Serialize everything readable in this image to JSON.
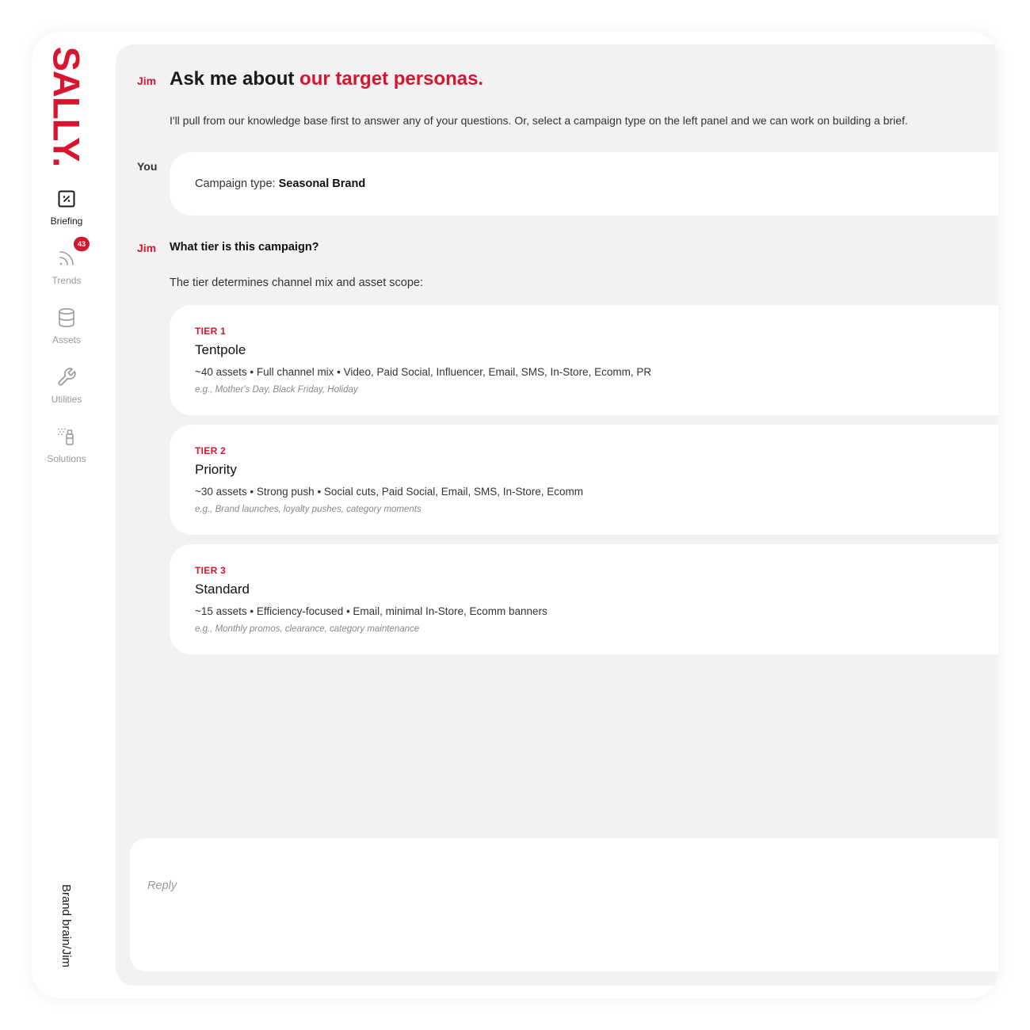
{
  "app": {
    "logo": "SALLY.",
    "brand_path": "Brand brain/Jim"
  },
  "colors": {
    "accent": "#d7152f",
    "panel": "#f2f2f2",
    "card": "#ffffff"
  },
  "sidebar": {
    "items": [
      {
        "label": "Briefing",
        "icon": "briefing-icon",
        "active": true
      },
      {
        "label": "Trends",
        "icon": "rss-icon",
        "badge": "43"
      },
      {
        "label": "Assets",
        "icon": "database-icon"
      },
      {
        "label": "Utilities",
        "icon": "wrench-icon"
      },
      {
        "label": "Solutions",
        "icon": "spray-bottle-icon"
      }
    ]
  },
  "chat": {
    "jim_name": "Jim",
    "you_name": "You",
    "headline_prefix": "Ask me about ",
    "headline_highlight": "our target personas.",
    "intro": "I'll pull from our knowledge base first to answer any of your questions. Or, select a campaign type on the left panel and we can work on building a brief.",
    "you_message_label": "Campaign type: ",
    "you_message_value": "Seasonal Brand",
    "question": "What tier is this campaign?",
    "question_sub": "The tier determines channel mix and asset scope:",
    "tiers": [
      {
        "label": "TIER 1",
        "name": "Tentpole",
        "desc": "~40 assets • Full channel mix • Video, Paid Social, Influencer, Email, SMS, In-Store, Ecomm, PR",
        "eg": "e.g., Mother's Day, Black Friday, Holiday"
      },
      {
        "label": "TIER 2",
        "name": "Priority",
        "desc": "~30 assets • Strong push • Social cuts, Paid Social, Email, SMS, In-Store, Ecomm",
        "eg": "e.g., Brand launches, loyalty pushes, category moments"
      },
      {
        "label": "TIER 3",
        "name": "Standard",
        "desc": "~15 assets • Efficiency-focused • Email, minimal In-Store, Ecomm banners",
        "eg": "e.g., Monthly promos, clearance, category maintenance"
      }
    ],
    "reply_placeholder": "Reply"
  }
}
